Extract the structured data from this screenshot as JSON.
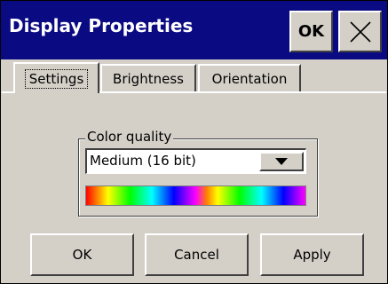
{
  "window": {
    "title": "Display Properties",
    "ok_label": "OK",
    "close_icon": "close-icon"
  },
  "tabs": [
    {
      "label": "Settings",
      "selected": true
    },
    {
      "label": "Brightness",
      "selected": false
    },
    {
      "label": "Orientation",
      "selected": false
    }
  ],
  "color_quality": {
    "group_label": "Color quality",
    "selected_value": "Medium (16 bit)",
    "spectrum_colors": [
      "#ff0000",
      "#ff8000",
      "#ffff00",
      "#80ff00",
      "#00ff00",
      "#00ff80",
      "#00ffff",
      "#0080ff",
      "#0000ff",
      "#8000ff",
      "#ff00ff"
    ]
  },
  "buttons": {
    "ok": "OK",
    "cancel": "Cancel",
    "apply": "Apply"
  },
  "colors": {
    "titlebar": "#0a0a82",
    "face": "#d4d0c8"
  }
}
